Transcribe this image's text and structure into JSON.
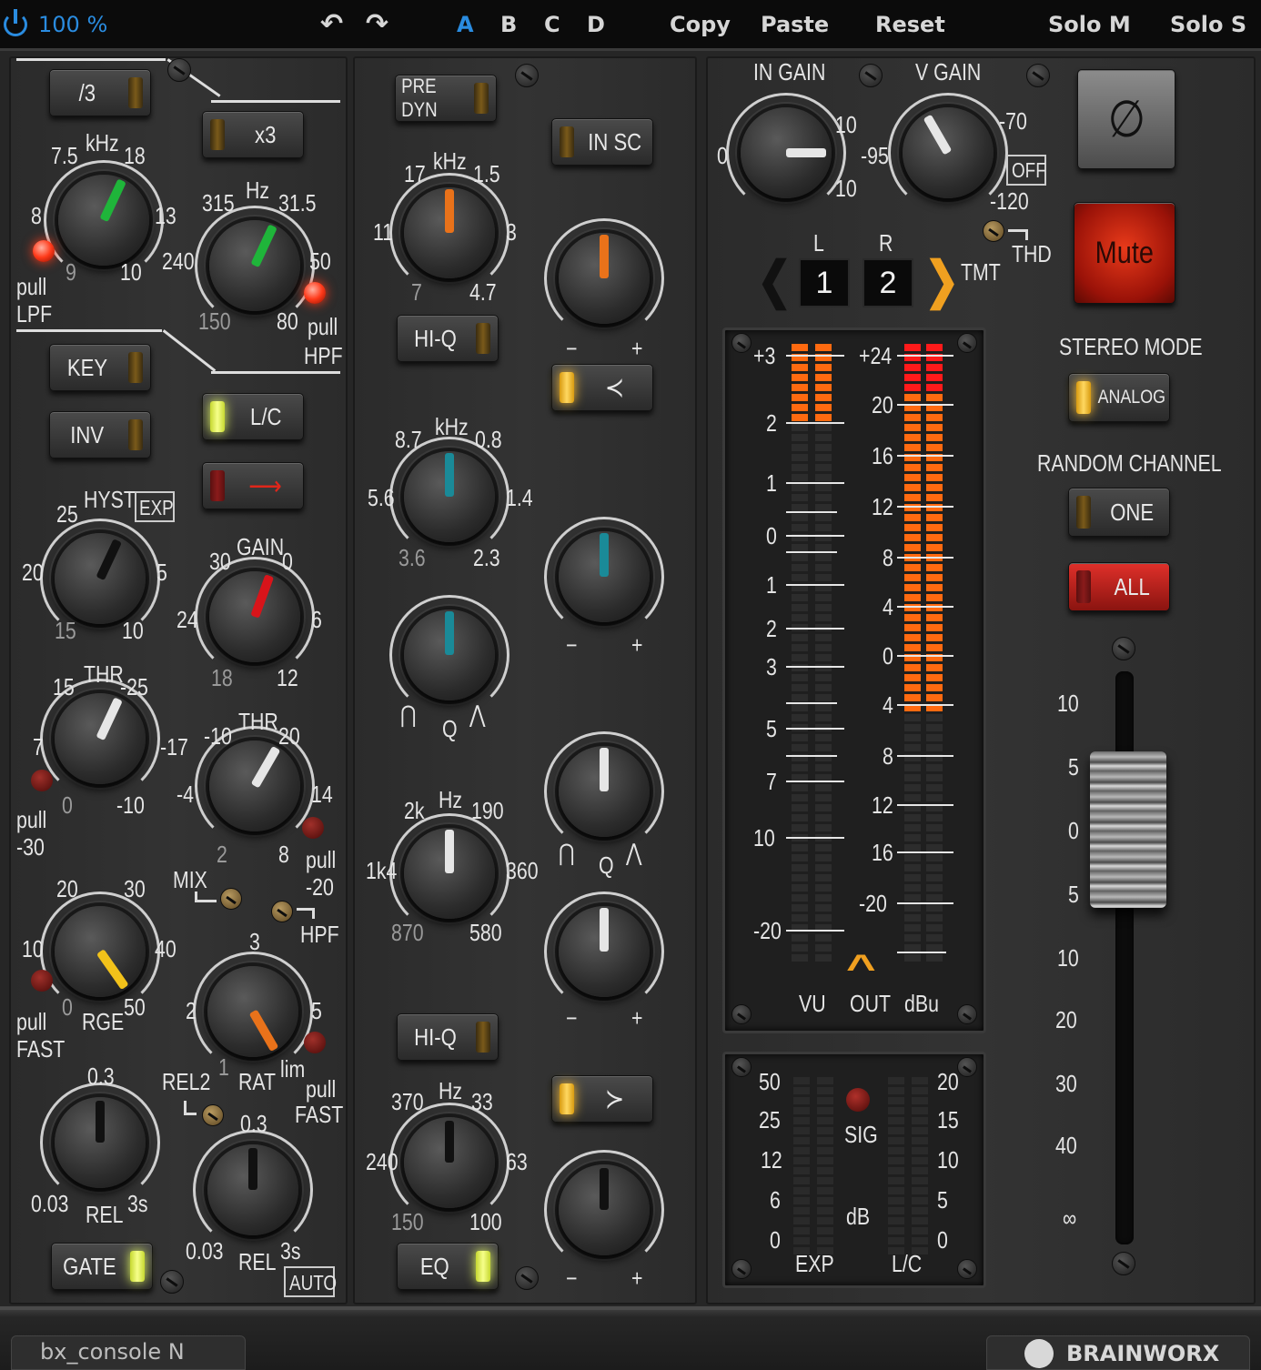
{
  "topbar": {
    "zoom": "100 %",
    "undo": "↶",
    "redo": "↷",
    "presets": [
      "A",
      "B",
      "C",
      "D"
    ],
    "selected_preset": "A",
    "copy": "Copy",
    "paste": "Paste",
    "reset": "Reset",
    "solo_m": "Solo M",
    "solo_s": "Solo S"
  },
  "filter": {
    "div3": "/3",
    "x3": "x3",
    "lpf_unit": "kHz",
    "lpf_scale": [
      "7.5",
      "18",
      "8",
      "13",
      "9",
      "10"
    ],
    "pull_lpf": [
      "pull",
      "LPF"
    ],
    "hpf_unit": "Hz",
    "hpf_scale": [
      "315",
      "31.5",
      "240",
      "50",
      "150",
      "80"
    ],
    "pull_hpf": [
      "pull",
      "HPF"
    ]
  },
  "dynamics": {
    "key": "KEY",
    "inv": "INV",
    "lc": "L/C",
    "hyst": "HYST",
    "exp": "EXP",
    "hyst_scale": [
      "25",
      "20",
      "5",
      "15",
      "10"
    ],
    "gain": "GAIN",
    "gain_scale": [
      "30",
      "0",
      "24",
      "6",
      "18",
      "12"
    ],
    "thr": "THR",
    "thr1_scale": [
      "15",
      "-25",
      "7",
      "-17",
      "0",
      "-10"
    ],
    "pull_30": [
      "pull",
      "-30"
    ],
    "thr2_scale": [
      "-10",
      "20",
      "-4",
      "14",
      "2",
      "8"
    ],
    "pull_20": [
      "pull",
      "-20"
    ],
    "mix": "MIX",
    "hpf": "HPF",
    "rge": "RGE",
    "rge_scale": [
      "20",
      "30",
      "10",
      "40",
      "0",
      "50"
    ],
    "pull_fast": [
      "pull",
      "FAST"
    ],
    "rat": "RAT",
    "rat_scale": [
      "3",
      "2",
      "5",
      "1",
      "lim"
    ],
    "pull_fast2": [
      "pull",
      "FAST"
    ],
    "rel2": "REL2",
    "rel": "REL",
    "rel_scale": [
      "0.3",
      "0.03",
      "3s"
    ],
    "rel2_scale": [
      "0.3",
      "0.03",
      "3s"
    ],
    "auto": "AUTO",
    "gate": "GATE"
  },
  "eq": {
    "pre_dyn": "PRE DYN",
    "in_sc": "IN SC",
    "hi_q": "HI-Q",
    "hi_q2": "HI-Q",
    "eq": "EQ",
    "khz": "kHz",
    "hz": "Hz",
    "q": "Q",
    "minus": "−",
    "plus": "+",
    "band1_scale": [
      "17",
      "1.5",
      "11",
      "3",
      "7",
      "4.7"
    ],
    "band2_scale": [
      "8.7",
      "0.8",
      "5.6",
      "1.4",
      "3.6",
      "2.3"
    ],
    "band3_scale": [
      "2k",
      "190",
      "1k4",
      "360",
      "870",
      "580"
    ],
    "band4_scale": [
      "370",
      "33",
      "240",
      "63",
      "150",
      "100"
    ]
  },
  "output": {
    "in_gain": "IN GAIN",
    "v_gain": "V GAIN",
    "in_scale": [
      "0",
      "10",
      "10"
    ],
    "v_scale": [
      "-95",
      "-70",
      "-120"
    ],
    "off": "OFF",
    "thd": "THD",
    "tmt": "TMT",
    "l": "L",
    "r": "R",
    "ch_left": "1",
    "ch_right": "2",
    "vu_scale": [
      "+3",
      "2",
      "1",
      "0",
      "1",
      "2",
      "3",
      "5",
      "7",
      "10",
      "-20"
    ],
    "dbu_scale": [
      "+24",
      "20",
      "16",
      "12",
      "8",
      "4",
      "0",
      "4",
      "8",
      "12",
      "16",
      "-20"
    ],
    "vu": "VU",
    "out": "OUT",
    "dbu": "dBu",
    "exp_scale": [
      "50",
      "25",
      "12",
      "6",
      "0"
    ],
    "lc_scale": [
      "20",
      "15",
      "10",
      "5",
      "0"
    ],
    "sig": "SIG",
    "db": "dB",
    "exp": "EXP",
    "lc": "L/C"
  },
  "master": {
    "phase": "∅",
    "mute": "Mute",
    "stereo_mode": "STEREO MODE",
    "analog": "ANALOG",
    "random_channel": "RANDOM CHANNEL",
    "one": "ONE",
    "all": "ALL",
    "fader_scale": [
      "10",
      "5",
      "0",
      "5",
      "10",
      "20",
      "30",
      "40",
      "∞"
    ]
  },
  "footer": {
    "product": "bx_console N",
    "brand": "BRAINWORX"
  }
}
